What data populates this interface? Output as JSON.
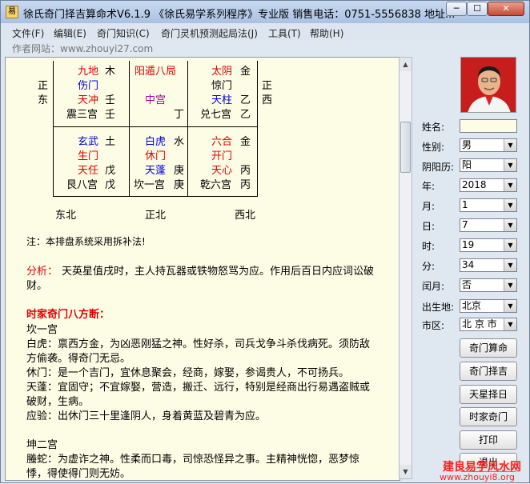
{
  "window": {
    "title": "徐氏奇门择吉算命术V6.1.9 《徐氏易学系列程序》专业版   销售电话：0751-5556838   地址...",
    "minimize": "0",
    "maximize": "1",
    "close": "r"
  },
  "menu": [
    "文件(F)",
    "编辑(E)",
    "奇门知识(C)",
    "奇门灵机预测起局法(J)",
    "工具(T)",
    "帮助(H)"
  ],
  "website": "作者网站：www.zhouyi27.com",
  "chart": {
    "left_dir": [
      "正",
      "东"
    ],
    "right_dir": [
      "正",
      "西"
    ],
    "top": [
      {
        "l1a": "九地",
        "l1b": "木",
        "l2": "伤门",
        "l3a": "天冲",
        "l3b": "壬",
        "l4a": "震三宫",
        "l4b": "壬"
      },
      {
        "l1": "阳遁八局",
        "l3": "中宫",
        "l4b": "丁"
      },
      {
        "l1a": "太阴",
        "l1b": "金",
        "l2": "惊门",
        "l3a": "天柱",
        "l3b": "乙",
        "l4a": "兑七宫",
        "l4b": "乙"
      }
    ],
    "bottom": [
      {
        "l1a": "玄武",
        "l1b": "土",
        "l2": "生门",
        "l3a": "天任",
        "l3b": "戊",
        "l4a": "艮八宫",
        "l4b": "戊"
      },
      {
        "l1a": "白虎",
        "l1b": "水",
        "l2": "休门",
        "l3a": "天蓬",
        "l3b": "庚",
        "l4a": "坎一宫",
        "l4b": "庚"
      },
      {
        "l1a": "六合",
        "l1b": "金",
        "l2": "开门",
        "l3a": "天心",
        "l3b": "丙",
        "l4a": "乾六宫",
        "l4b": "丙"
      }
    ],
    "bottom_dir": [
      "东北",
      "正北",
      "西北"
    ]
  },
  "text": {
    "note": "注：本排盘系统采用拆补法!",
    "analysis_label": "分析：",
    "analysis_1": "天英星值戌时，主人持瓦器或铁物怒骂为应。作用后百日内应词讼破",
    "analysis_2": "财。",
    "section_title": "时家奇门八方断：",
    "kan": "坎一宫",
    "baihu_1": "白虎：禀西方金，为凶恶刚猛之神。性好杀，司兵戈争斗杀伐病死。须防敌",
    "baihu_2": "方偷袭。得奇门无忌。",
    "xiumen": "休门：是一个吉门，宜休息聚会，经商，嫁娶，参谒贵人，不可扬兵。",
    "tianpeng_1": "天蓬：宜固守；不宜嫁娶，营造，搬迁、远行，特别是经商出行易遇盗贼或",
    "tianpeng_2": "破财，生病。",
    "yingyan": "应验：出休门三十里逢阴人，身着黄蓝及碧青为应。",
    "kun": "坤二宫",
    "tengshe_1": "螣蛇：为虚诈之神。性柔而口毒，司惊恐怪异之事。主精神恍惚，恶梦惊",
    "tengshe_2": "悸，得使得门则无妨。"
  },
  "form": {
    "name_label": "姓名:",
    "name_value": "",
    "gender_label": "性别:",
    "gender_value": "男",
    "calendar_label": "阴阳历:",
    "calendar_value": "阳",
    "year_label": "年:",
    "year_value": "2018",
    "month_label": "月:",
    "month_value": "1",
    "day_label": "日:",
    "day_value": "7",
    "hour_label": "时:",
    "hour_value": "19",
    "minute_label": "分:",
    "minute_value": "34",
    "leap_label": "闰月:",
    "leap_value": "否",
    "birthplace_label": "出生地:",
    "birthplace_value": "北京",
    "district_label": "市区:",
    "district_value": "北 京 市"
  },
  "buttons": [
    "奇门算命",
    "奇门择吉",
    "天星择日",
    "时家奇门",
    "打印",
    "退出"
  ],
  "watermark": {
    "line1": "建良易学风水网",
    "line2": "www.zhouyi8.org"
  },
  "colors": {
    "red": "#e00000",
    "blue": "#0000e0",
    "magenta": "#b000b0",
    "paper": "#fdfde6"
  }
}
